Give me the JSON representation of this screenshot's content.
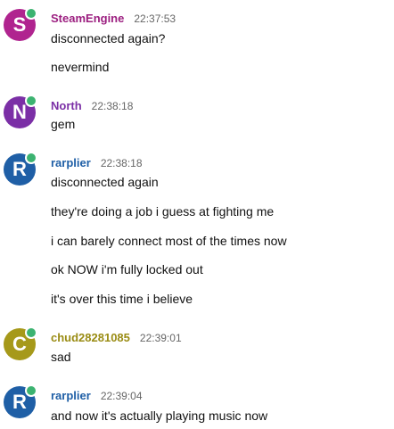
{
  "colors": {
    "presence_online": "#3cb371",
    "timestamp_text": "#666666"
  },
  "messages": [
    {
      "username": "SteamEngine",
      "initial": "S",
      "avatar_color": "#b0248f",
      "name_color": "#9c1f80",
      "time": "22:37:53",
      "lines": [
        "disconnected again?",
        "nevermind"
      ]
    },
    {
      "username": "North",
      "initial": "N",
      "avatar_color": "#7b2fa6",
      "name_color": "#7b2fa6",
      "time": "22:38:18",
      "lines": [
        "gem"
      ]
    },
    {
      "username": "rarplier",
      "initial": "R",
      "avatar_color": "#1f5fa6",
      "name_color": "#1f5fa6",
      "time": "22:38:18",
      "lines": [
        "disconnected again",
        "they're doing a job i guess at fighting me",
        "i can barely connect most of the times now",
        "ok NOW i'm fully locked out",
        "it's over this time i believe"
      ]
    },
    {
      "username": "chud28281085",
      "initial": "C",
      "avatar_color": "#a6991a",
      "name_color": "#9a8c14",
      "time": "22:39:01",
      "lines": [
        "sad"
      ]
    },
    {
      "username": "rarplier",
      "initial": "R",
      "avatar_color": "#1f5fa6",
      "name_color": "#1f5fa6",
      "time": "22:39:04",
      "lines": [
        "and now it's actually playing music now"
      ]
    }
  ]
}
